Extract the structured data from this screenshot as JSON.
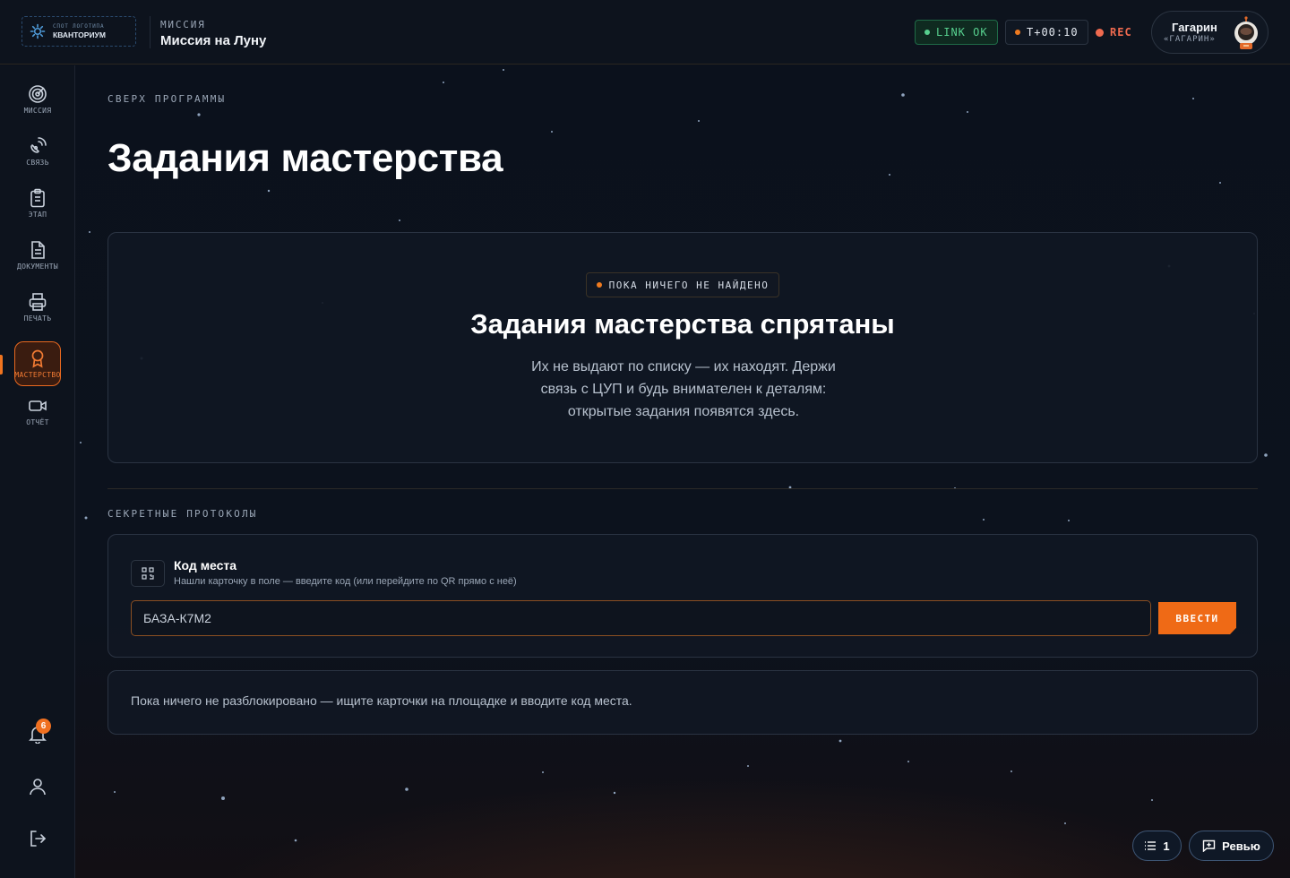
{
  "header": {
    "logo_small": "СПОТ ЛОГОТИПА",
    "logo_main": "КВАНТОРИУМ",
    "mission_kicker": "МИССИЯ",
    "mission_title": "Миссия на Луну",
    "link_status": "LINK OK",
    "timer": "T+00:10",
    "rec_label": "REC",
    "user_name": "Гагарин",
    "user_callsign": "«ГАГАРИН»",
    "colors": {
      "link_green": "#57d08e",
      "accent_orange": "#ef6a16",
      "rec_red": "#ef6a4f"
    }
  },
  "sidebar": {
    "items": [
      {
        "label": "МИССИЯ",
        "icon": "radar-icon"
      },
      {
        "label": "СВЯЗЬ",
        "icon": "satellite-icon"
      },
      {
        "label": "ЭТАП",
        "icon": "clipboard-icon"
      },
      {
        "label": "ДОКУМЕНТЫ",
        "icon": "document-icon"
      },
      {
        "label": "ПЕЧАТЬ",
        "icon": "printer-icon"
      },
      {
        "label": "МАСТЕРСТВО",
        "icon": "award-icon",
        "active": true
      },
      {
        "label": "ОТЧЁТ",
        "icon": "video-icon"
      }
    ],
    "notifications_count": "6"
  },
  "main": {
    "kicker": "СВЕРХ ПРОГРАММЫ",
    "title": "Задания мастерства",
    "hero": {
      "chip": "ПОКА НИЧЕГО НЕ НАЙДЕНО",
      "title": "Задания мастерства спрятаны",
      "desc_line1": "Их не выдают по списку — их находят. Держи",
      "desc_line2": "связь с ЦУП и будь внимателен к деталям:",
      "desc_line3": "открытые задания появятся здесь."
    },
    "protocols_kicker": "СЕКРЕТНЫЕ ПРОТОКОЛЫ",
    "code": {
      "title": "Код места",
      "hint": "Нашли карточку в поле — введите код (или перейдите по QR прямо с неё)",
      "placeholder": "БАЗА-К7М2",
      "button": "ВВЕСТИ"
    },
    "empty_text": "Пока ничего не разблокировано — ищите карточки на площадке и вводите код места."
  },
  "floating": {
    "list_count": "1",
    "review_label": "Ревью"
  }
}
